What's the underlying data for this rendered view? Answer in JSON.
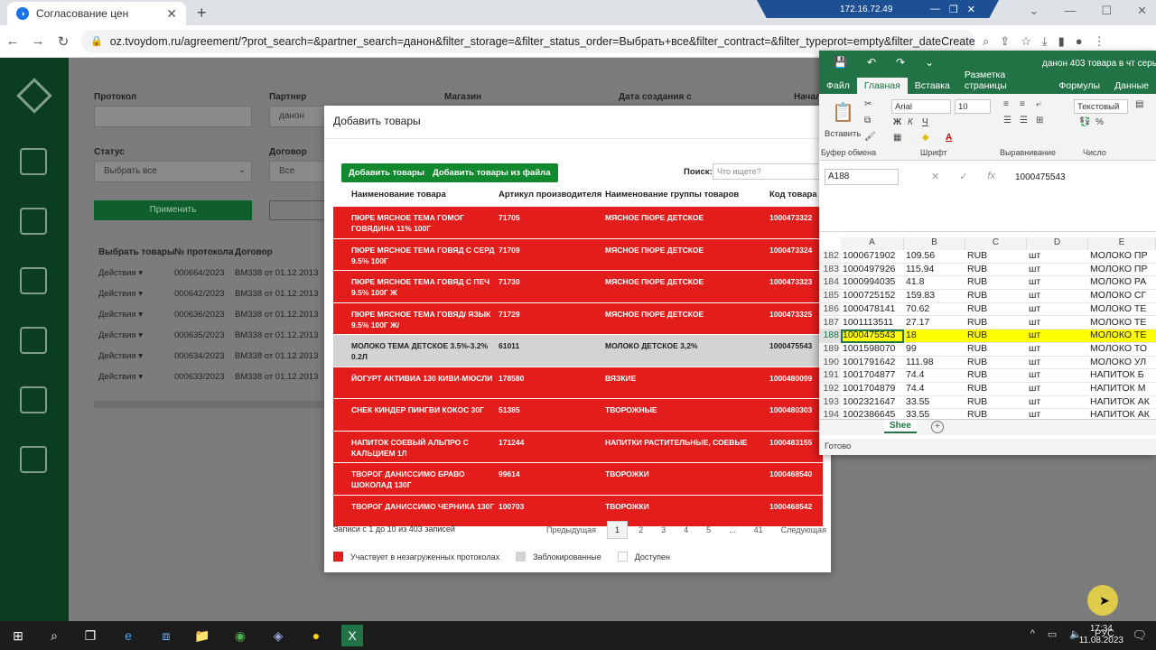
{
  "browser": {
    "tab_title": "Согласование цен",
    "tab_close": "✕",
    "new_tab": "+",
    "url": "oz.tvoydom.ru/agreement/?prot_search=&partner_search=данон&filter_storage=&filter_status_order=Выбрать+все&filter_contract=&filter_typeprot=empty&filter_dateCreate_from=_...",
    "remote_ip": "172.16.72.49"
  },
  "filters": {
    "protocol_label": "Протокол",
    "partner_label": "Партнер",
    "partner_value": "данон",
    "store_label": "Магазин",
    "date_created_label": "Дата создания с",
    "start_label": "Начал",
    "status_label": "Статус",
    "status_value": "Выбрать все",
    "contract_label": "Договор",
    "contract_value": "Все",
    "apply_label": "Применить"
  },
  "bg_table": {
    "headers": [
      "Выбрать товары",
      "№ протокола",
      "Договор"
    ],
    "rows": [
      [
        "Действия ▾",
        "000664/2023",
        "ВМ338 от 01.12.2013"
      ],
      [
        "Действия ▾",
        "000642/2023",
        "ВМ338 от 01.12.2013"
      ],
      [
        "Действия ▾",
        "000636/2023",
        "ВМ338 от 01.12.2013"
      ],
      [
        "Действия ▾",
        "000635/2023",
        "ВМ338 от 01.12.2013"
      ],
      [
        "Действия ▾",
        "000634/2023",
        "ВМ338 от 01.12.2013"
      ],
      [
        "Действия ▾",
        "000633/2023",
        "ВМ338 от 01.12.2013"
      ]
    ]
  },
  "modal": {
    "title": "Добавить товары",
    "add_btn": "Добавить товары",
    "add_file_btn": "Добавить товары из файла",
    "search_label": "Поиск:",
    "search_placeholder": "Что ищете?",
    "headers": [
      "Наименование товара",
      "Артикул производителя",
      "Наименование группы товаров",
      "Код товара"
    ],
    "rows": [
      {
        "status": "red",
        "name": "ПЮРЕ МЯСНОЕ ТЕМА ГОМОГ ГОВЯДИНА 11% 100Г",
        "article": "71705",
        "group": "МЯСНОЕ ПЮРЕ ДЕТСКОЕ",
        "code": "1000473322"
      },
      {
        "status": "red",
        "name": "ПЮРЕ МЯСНОЕ ТЕМА ГОВЯД С СЕРД 9.5% 100Г",
        "article": "71709",
        "group": "МЯСНОЕ ПЮРЕ ДЕТСКОЕ",
        "code": "1000473324"
      },
      {
        "status": "red",
        "name": "ПЮРЕ МЯСНОЕ ТЕМА ГОВЯД С ПЕЧ 9.5% 100Г Ж",
        "article": "71730",
        "group": "МЯСНОЕ ПЮРЕ ДЕТСКОЕ",
        "code": "1000473323"
      },
      {
        "status": "red",
        "name": "ПЮРЕ МЯСНОЕ ТЕМА ГОВЯД/ ЯЗЫК 9.5% 100Г Ж/",
        "article": "71729",
        "group": "МЯСНОЕ ПЮРЕ ДЕТСКОЕ",
        "code": "1000473325"
      },
      {
        "status": "grey",
        "name": "МОЛОКО ТЕМА ДЕТСКОЕ 3.5%-3.2% 0.2Л",
        "article": "61011",
        "group": "МОЛОКО ДЕТСКОЕ 3,2%",
        "code": "1000475543"
      },
      {
        "status": "red",
        "name": "ЙОГУРТ АКТИВИА 130 КИВИ-МЮСЛИ",
        "article": "178580",
        "group": "ВЯЗКИЕ",
        "code": "1000480099"
      },
      {
        "status": "red",
        "name": "СНЕК КИНДЕР ПИНГВИ КОКОС 30Г",
        "article": "51385",
        "group": "ТВОРОЖНЫЕ",
        "code": "1000480303"
      },
      {
        "status": "red",
        "name": "НАПИТОК СОЕВЫЙ АЛЬПРО С КАЛЬЦИЕМ 1Л",
        "article": "171244",
        "group": "НАПИТКИ РАСТИТЕЛЬНЫЕ, СОЕВЫЕ",
        "code": "1000483155"
      },
      {
        "status": "red",
        "name": "ТВОРОГ ДАНИССИМО БРАВО ШОКОЛАД 130Г",
        "article": "99614",
        "group": "ТВОРОЖКИ",
        "code": "1000468540"
      },
      {
        "status": "red",
        "name": "ТВОРОГ ДАНИССИМО ЧЕРНИКА 130Г",
        "article": "100703",
        "group": "ТВОРОЖКИ",
        "code": "1000468542"
      }
    ],
    "records_info": "Записи с 1 до 10 из 403 записей",
    "prev": "Предыдущая",
    "pages": [
      "1",
      "2",
      "3",
      "4",
      "5",
      "...",
      "41"
    ],
    "next": "Следующая",
    "legend": [
      "Участвует в незагруженных протоколах",
      "Заблокированные",
      "Доступен"
    ],
    "colors": {
      "red": "#e31c1c",
      "grey": "#d3d3d3",
      "green": "#12892f"
    }
  },
  "excel": {
    "doc_title": "данон 403 товара в чт серь",
    "tabs": [
      "Файл",
      "Главная",
      "Вставка",
      "Разметка страницы",
      "Формулы",
      "Данные"
    ],
    "paste_label": "Вставить",
    "font_name": "Arial",
    "font_size": "10",
    "number_format": "Текстовый",
    "groups": [
      "Буфер обмена",
      "Шрифт",
      "Выравнивание",
      "Число"
    ],
    "name_box": "A188",
    "formula_value": "1000475543",
    "columns": [
      "A",
      "B",
      "C",
      "D",
      "E"
    ],
    "rows": [
      [
        "182",
        "1000671902",
        "109.56",
        "RUB",
        "шт",
        "МОЛОКО ПР"
      ],
      [
        "183",
        "1000497926",
        "115.94",
        "RUB",
        "шт",
        "МОЛОКО ПР"
      ],
      [
        "184",
        "1000994035",
        "41.8",
        "RUB",
        "шт",
        "МОЛОКО РА"
      ],
      [
        "185",
        "1000725152",
        "159.83",
        "RUB",
        "шт",
        "МОЛОКО СГ"
      ],
      [
        "186",
        "1000478141",
        "70.62",
        "RUB",
        "шт",
        "МОЛОКО ТЕ"
      ],
      [
        "187",
        "1001113511",
        "27.17",
        "RUB",
        "шт",
        "МОЛОКО ТЕ"
      ],
      [
        "188",
        "1000475543",
        "18",
        "RUB",
        "шт",
        "МОЛОКО ТЕ"
      ],
      [
        "189",
        "1001598070",
        "99",
        "RUB",
        "шт",
        "МОЛОКО ТО"
      ],
      [
        "190",
        "1001791642",
        "111.98",
        "RUB",
        "шт",
        "МОЛОКО УЛ"
      ],
      [
        "191",
        "1001704877",
        "74.4",
        "RUB",
        "шт",
        "НАПИТОК Б"
      ],
      [
        "192",
        "1001704879",
        "74.4",
        "RUB",
        "шт",
        "НАПИТОК М"
      ],
      [
        "193",
        "1002321647",
        "33.55",
        "RUB",
        "шт",
        "НАПИТОК АК"
      ],
      [
        "194",
        "1002386645",
        "33.55",
        "RUB",
        "шт",
        "НАПИТОК АК"
      ]
    ],
    "sheet_tab": "Shee",
    "status": "Готово"
  },
  "taskbar": {
    "lang": "РУС",
    "time": "17:34",
    "date": "11.08.2023"
  }
}
